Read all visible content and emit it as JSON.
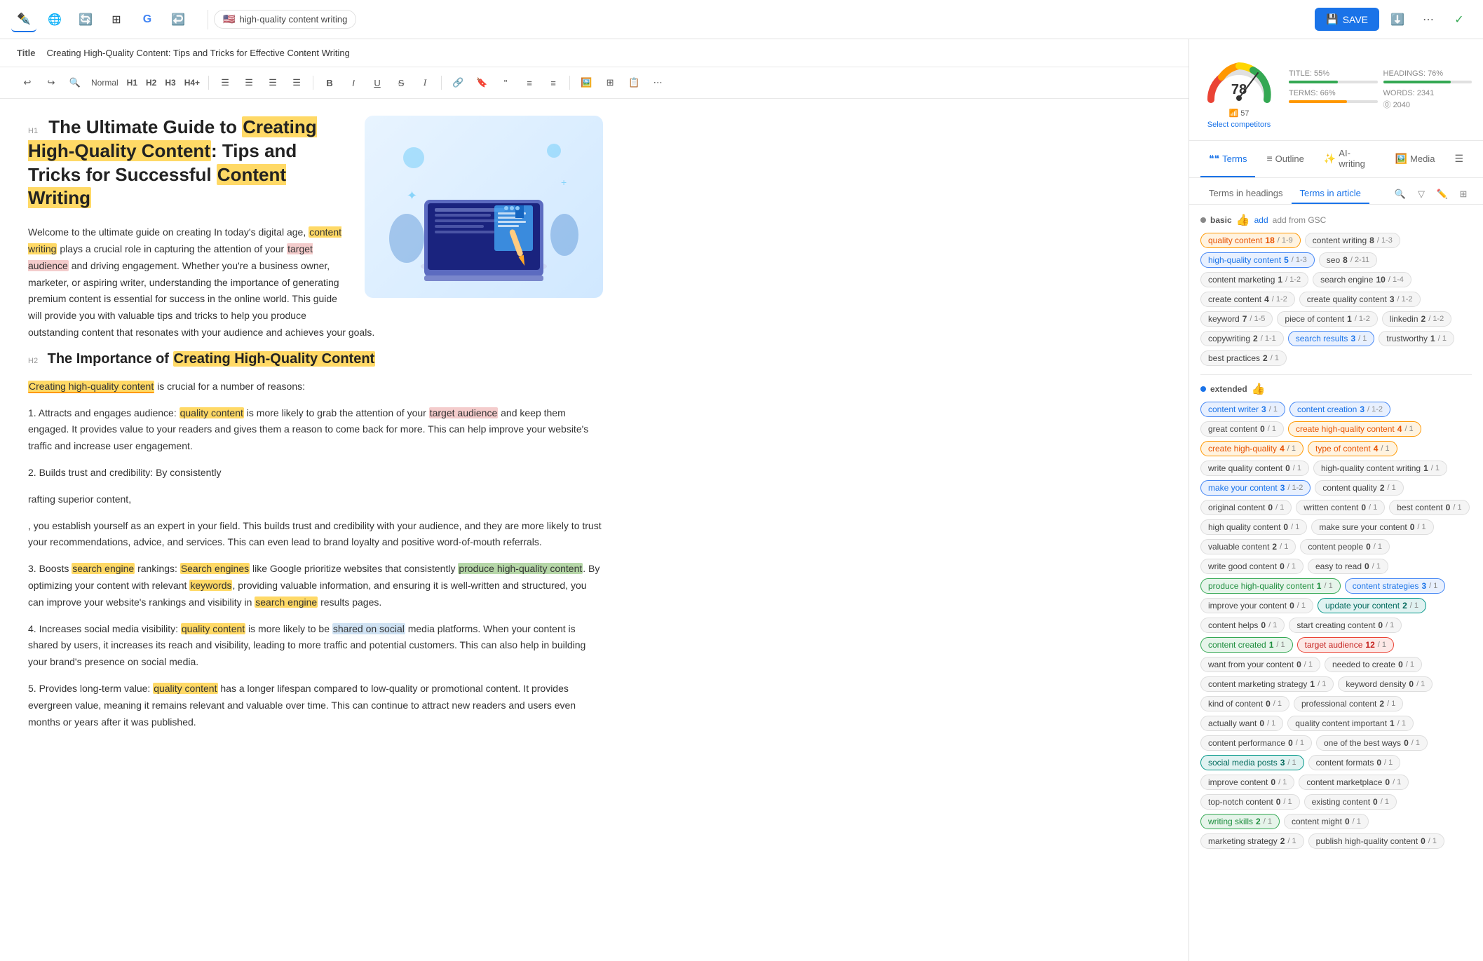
{
  "nav": {
    "icons": [
      "✒️",
      "🌐",
      "🔄",
      "⊞",
      "G",
      "↩️"
    ],
    "keyword": "high-quality content writing",
    "save_label": "SAVE",
    "right_icons": [
      "⬇️",
      "⋯",
      "✓"
    ]
  },
  "editor": {
    "title_label": "Title",
    "title_text": "Creating High-Quality Content: Tips and Tricks for Effective Content Writing",
    "h1_marker": "H1",
    "h1_text": "The Ultimate Guide to Creating High-Quality Content: Tips and Tricks for Successful Content Writing",
    "h2_marker": "H2",
    "h2_text": "The Importance of Creating High-Quality Content",
    "para1": "Welcome to the ultimate guide on creating In today's digital age, content writing plays a crucial role in capturing the attention of your target audience and driving engagement. Whether you're a business owner, marketer, or aspiring writer, understanding the importance of generating premium content is essential for success in the online world. This guide will provide you with valuable tips and tricks to help you produce outstanding content that resonates with your audience and achieves your goals.",
    "para2_intro": "Creating high-quality content is crucial for a number of reasons:",
    "para2_1": "1. Attracts and engages audience: quality content is more likely to grab the attention of your target audience and keep them engaged. It provides value to your readers and gives them a reason to come back for more. This can help improve your website's traffic and increase user engagement.",
    "para2_2": "2. Builds trust and credibility: By consistently",
    "para2_3": "rafting superior content,",
    "para2_4": ", you establish yourself as an expert in your field. This builds trust and credibility with your audience, and they are more likely to trust your recommendations, advice, and services. This can even lead to brand loyalty and positive word-of-mouth referrals.",
    "para2_5": "3. Boosts search engine rankings: Search engines like Google prioritize websites that consistently produce high-quality content. By optimizing your content with relevant keywords, providing valuable information, and ensuring it is well-written and structured, you can improve your website's rankings and visibility in search engine results pages.",
    "para2_6": "4. Increases social media visibility: quality content is more likely to be shared on social media platforms. When your content is shared by users, it increases its reach and visibility, leading to more traffic and potential customers. This can also help in building your brand's presence on social media.",
    "para2_7": "5. Provides long-term value: quality content has a longer lifespan compared to low-quality or promotional content. It provides evergreen value, meaning it remains relevant and valuable over time. This can continue to attract new readers and users even months or years after it was published."
  },
  "score_panel": {
    "score": 78,
    "wifi_score": 57,
    "select_competitors": "Select competitors",
    "title_pct": "TITLE: 55%",
    "headings_pct": "HEADINGS: 76%",
    "terms_pct": "TERMS: 66%",
    "words": "WORDS: 2341",
    "words_target": "2040"
  },
  "tabs": [
    {
      "id": "terms",
      "label": "Terms",
      "icon": "❝❝",
      "active": true
    },
    {
      "id": "outline",
      "label": "Outline",
      "icon": "≡"
    },
    {
      "id": "ai-writing",
      "label": "AI-writing",
      "icon": "✨"
    },
    {
      "id": "media",
      "label": "Media",
      "icon": "🖼️"
    },
    {
      "id": "settings",
      "label": "",
      "icon": "☰"
    }
  ],
  "terms_subtabs": [
    {
      "id": "headings",
      "label": "Terms in headings"
    },
    {
      "id": "article",
      "label": "Terms in article",
      "active": true
    }
  ],
  "basic_tags": [
    {
      "text": "quality content",
      "count": "18",
      "fraction": "1-9",
      "type": "orange"
    },
    {
      "text": "content writing",
      "count": "8",
      "fraction": "1-3",
      "type": "gray"
    },
    {
      "text": "high-quality content",
      "count": "5",
      "fraction": "1-3",
      "type": "blue"
    },
    {
      "text": "seo",
      "count": "8",
      "fraction": "2-11",
      "type": "gray"
    },
    {
      "text": "content marketing",
      "count": "1",
      "fraction": "1-2",
      "type": "gray"
    },
    {
      "text": "search engine",
      "count": "10",
      "fraction": "1-4",
      "type": "gray"
    },
    {
      "text": "create content",
      "count": "4",
      "fraction": "1-2",
      "type": "gray"
    },
    {
      "text": "create quality content",
      "count": "3",
      "fraction": "1-2",
      "type": "gray"
    },
    {
      "text": "keyword",
      "count": "7",
      "fraction": "1-5",
      "type": "gray"
    },
    {
      "text": "piece of content",
      "count": "1",
      "fraction": "1-2",
      "type": "gray"
    },
    {
      "text": "linkedin",
      "count": "2",
      "fraction": "1-2",
      "type": "gray"
    },
    {
      "text": "copywriting",
      "count": "2",
      "fraction": "1-1",
      "type": "gray"
    },
    {
      "text": "search results",
      "count": "3",
      "fraction": "1",
      "type": "blue"
    },
    {
      "text": "trustworthy",
      "count": "1",
      "fraction": "1",
      "type": "gray"
    },
    {
      "text": "best practices",
      "count": "2",
      "fraction": "1",
      "type": "gray"
    }
  ],
  "extended_tags": [
    {
      "text": "content writer",
      "count": "3",
      "fraction": "1",
      "type": "blue"
    },
    {
      "text": "content creation",
      "count": "3",
      "fraction": "1-2",
      "type": "blue"
    },
    {
      "text": "great content",
      "count": "0",
      "fraction": "1",
      "type": "gray"
    },
    {
      "text": "create high-quality content",
      "count": "4",
      "fraction": "1",
      "type": "orange"
    },
    {
      "text": "create high-quality",
      "count": "4",
      "fraction": "1",
      "type": "orange"
    },
    {
      "text": "type of content",
      "count": "4",
      "fraction": "1",
      "type": "orange"
    },
    {
      "text": "write quality content",
      "count": "0",
      "fraction": "1",
      "type": "gray"
    },
    {
      "text": "high-quality content writing",
      "count": "1",
      "fraction": "1",
      "type": "gray"
    },
    {
      "text": "make your content",
      "count": "3",
      "fraction": "1-2",
      "type": "blue"
    },
    {
      "text": "content quality",
      "count": "2",
      "fraction": "1",
      "type": "gray"
    },
    {
      "text": "original content",
      "count": "0",
      "fraction": "1",
      "type": "gray"
    },
    {
      "text": "written content",
      "count": "0",
      "fraction": "1",
      "type": "gray"
    },
    {
      "text": "best content",
      "count": "0",
      "fraction": "1",
      "type": "gray"
    },
    {
      "text": "high quality content",
      "count": "0",
      "fraction": "1",
      "type": "gray"
    },
    {
      "text": "make sure your content",
      "count": "0",
      "fraction": "1",
      "type": "gray"
    },
    {
      "text": "valuable content",
      "count": "2",
      "fraction": "1",
      "type": "gray"
    },
    {
      "text": "content people",
      "count": "0",
      "fraction": "1",
      "type": "gray"
    },
    {
      "text": "write good content",
      "count": "0",
      "fraction": "1",
      "type": "gray"
    },
    {
      "text": "easy to read",
      "count": "0",
      "fraction": "1",
      "type": "gray"
    },
    {
      "text": "produce high-quality content",
      "count": "1",
      "fraction": "1",
      "type": "green"
    },
    {
      "text": "content strategies",
      "count": "3",
      "fraction": "1",
      "type": "blue"
    },
    {
      "text": "improve your content",
      "count": "0",
      "fraction": "1",
      "type": "gray"
    },
    {
      "text": "update your content",
      "count": "2",
      "fraction": "1",
      "type": "teal"
    },
    {
      "text": "content helps",
      "count": "0",
      "fraction": "1",
      "type": "gray"
    },
    {
      "text": "start creating content",
      "count": "0",
      "fraction": "1",
      "type": "gray"
    },
    {
      "text": "content created",
      "count": "1",
      "fraction": "1",
      "type": "green"
    },
    {
      "text": "target audience",
      "count": "12",
      "fraction": "1",
      "type": "red"
    },
    {
      "text": "want from your content",
      "count": "0",
      "fraction": "1",
      "type": "gray"
    },
    {
      "text": "needed to create",
      "count": "0",
      "fraction": "1",
      "type": "gray"
    },
    {
      "text": "content marketing strategy",
      "count": "1",
      "fraction": "1",
      "type": "gray"
    },
    {
      "text": "keyword density",
      "count": "0",
      "fraction": "1",
      "type": "gray"
    },
    {
      "text": "kind of content",
      "count": "0",
      "fraction": "1",
      "type": "gray"
    },
    {
      "text": "professional content",
      "count": "2",
      "fraction": "1",
      "type": "gray"
    },
    {
      "text": "actually want",
      "count": "0",
      "fraction": "1",
      "type": "gray"
    },
    {
      "text": "quality content important",
      "count": "1",
      "fraction": "1",
      "type": "gray"
    },
    {
      "text": "content performance",
      "count": "0",
      "fraction": "1",
      "type": "gray"
    },
    {
      "text": "one of the best ways",
      "count": "0",
      "fraction": "1",
      "type": "gray"
    },
    {
      "text": "social media posts",
      "count": "3",
      "fraction": "1",
      "type": "teal"
    },
    {
      "text": "content formats",
      "count": "0",
      "fraction": "1",
      "type": "gray"
    },
    {
      "text": "improve content",
      "count": "0",
      "fraction": "1",
      "type": "gray"
    },
    {
      "text": "content marketplace",
      "count": "0",
      "fraction": "1",
      "type": "gray"
    },
    {
      "text": "top-notch content",
      "count": "0",
      "fraction": "1",
      "type": "gray"
    },
    {
      "text": "existing content",
      "count": "0",
      "fraction": "1",
      "type": "gray"
    },
    {
      "text": "writing skills",
      "count": "2",
      "fraction": "1",
      "type": "green"
    },
    {
      "text": "content might",
      "count": "0",
      "fraction": "1",
      "type": "gray"
    },
    {
      "text": "marketing strategy",
      "count": "2",
      "fraction": "1",
      "type": "gray"
    },
    {
      "text": "publish high-quality content",
      "count": "0",
      "fraction": "1",
      "type": "gray"
    }
  ]
}
